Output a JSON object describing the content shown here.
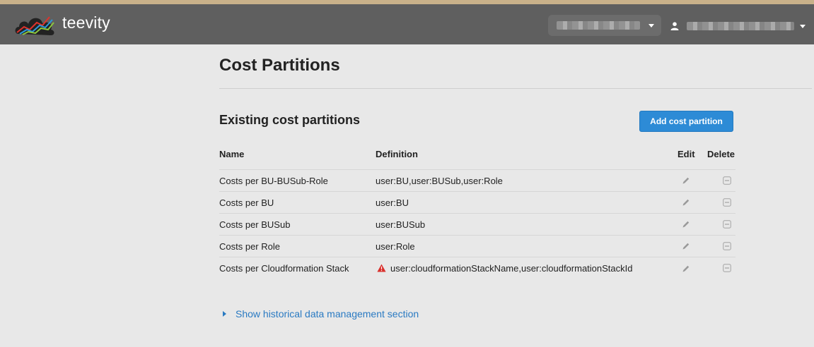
{
  "app": {
    "brand": "teevity"
  },
  "navbar": {
    "tenant_value": "",
    "user_value": ""
  },
  "page": {
    "title": "Cost Partitions",
    "section_title": "Existing cost partitions",
    "add_button_label": "Add cost partition"
  },
  "table": {
    "headers": {
      "name": "Name",
      "definition": "Definition",
      "edit": "Edit",
      "delete": "Delete"
    },
    "rows": [
      {
        "name": "Costs per BU-BUSub-Role",
        "definition": "user:BU,user:BUSub,user:Role",
        "warning": false
      },
      {
        "name": "Costs per BU",
        "definition": "user:BU",
        "warning": false
      },
      {
        "name": "Costs per BUSub",
        "definition": "user:BUSub",
        "warning": false
      },
      {
        "name": "Costs per Role",
        "definition": "user:Role",
        "warning": false
      },
      {
        "name": "Costs per Cloudformation Stack",
        "definition": "user:cloudformationStackName,user:cloudformationStackId",
        "warning": true
      }
    ]
  },
  "history": {
    "toggle_label": "Show historical data management section"
  },
  "colors": {
    "navbar": "#5f5f5f",
    "accent": "#2d8bd6",
    "link": "#2a7ac2",
    "warning": "#d9302c"
  },
  "icons": {
    "logo": "teevity-cloud-chart-logo",
    "user": "user-icon",
    "edit": "pencil-icon",
    "delete": "minus-box-icon",
    "warning": "warning-triangle-icon",
    "expand": "caret-right-icon",
    "dropdown": "caret-down-icon"
  }
}
